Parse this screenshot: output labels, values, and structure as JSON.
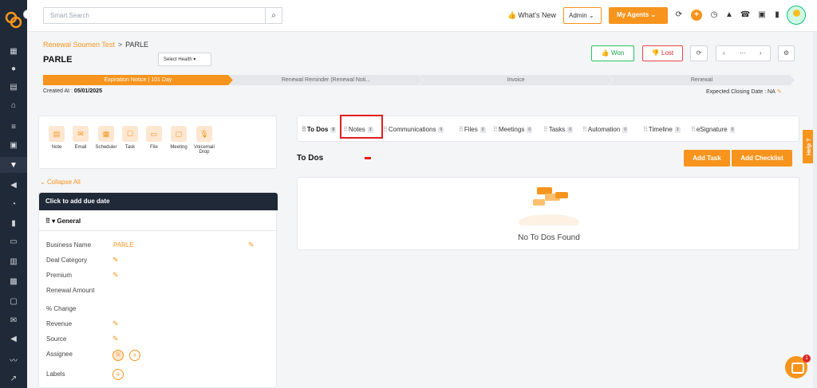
{
  "search": {
    "placeholder": "Smart Search"
  },
  "topbar": {
    "whats_new": "What's New",
    "admin": "Admin",
    "my_agents": "My Agents"
  },
  "breadcrumb": {
    "parent": "Renewal Soumen Test",
    "current": "PARLE"
  },
  "page_title": "PARLE",
  "select_health": "Select Health",
  "actions": {
    "won": "Won",
    "lost": "Lost"
  },
  "stages": [
    {
      "label": "Expiration Notice | 101 Day",
      "active": true
    },
    {
      "label": "Renewal Reminder (Renewal Noti...",
      "active": false
    },
    {
      "label": "Invoice",
      "active": false
    },
    {
      "label": "Renewal",
      "active": false
    }
  ],
  "created_at": {
    "label": "Created At :",
    "value": "05/01/2025"
  },
  "closing_date": "Expected Closing Date : NA",
  "quick_actions": [
    {
      "label": "Note",
      "icon": "note-icon"
    },
    {
      "label": "Email",
      "icon": "email-icon"
    },
    {
      "label": "Scheduler",
      "icon": "scheduler-icon"
    },
    {
      "label": "Task",
      "icon": "task-icon"
    },
    {
      "label": "File",
      "icon": "file-icon"
    },
    {
      "label": "Meeting",
      "icon": "meeting-icon"
    },
    {
      "label": "Voicemail",
      "label2": "Drop",
      "icon": "voicemail-icon"
    }
  ],
  "collapse_all": "Collapse All",
  "due_date_bar": "Click to add due date",
  "general_title": "General",
  "fields": [
    {
      "label": "Business Name",
      "value": "PARLE"
    },
    {
      "label": "Deal Category",
      "value": ""
    },
    {
      "label": "Premium",
      "value": ""
    },
    {
      "label": "Renewal Amount",
      "value": ""
    },
    {
      "label": "% Change",
      "value": ""
    },
    {
      "label": "Revenue",
      "value": ""
    },
    {
      "label": "Source",
      "value": ""
    },
    {
      "label": "Assignee",
      "value": ""
    },
    {
      "label": "Labels",
      "value": ""
    }
  ],
  "assignee_initials": "SI",
  "tabs": [
    {
      "label": "To Dos",
      "count": "0"
    },
    {
      "label": "Notes",
      "count": "3"
    },
    {
      "label": "Communications",
      "count": "0"
    },
    {
      "label": "Files",
      "count": "0"
    },
    {
      "label": "Meetings",
      "count": "0"
    },
    {
      "label": "Tasks",
      "count": "0"
    },
    {
      "label": "Automation",
      "count": "0"
    },
    {
      "label": "Timeline",
      "count": "3"
    },
    {
      "label": "eSignature",
      "count": "0"
    }
  ],
  "todos": {
    "title": "To Dos",
    "add_task": "Add Task",
    "add_checklist": "Add Checklist",
    "empty": "No To Dos Found"
  },
  "help": "Help",
  "chat_badge": "1",
  "colors": {
    "accent": "#f7941d",
    "sidebar": "#1f2937",
    "won": "#22c55e",
    "lost": "#ef4444"
  }
}
